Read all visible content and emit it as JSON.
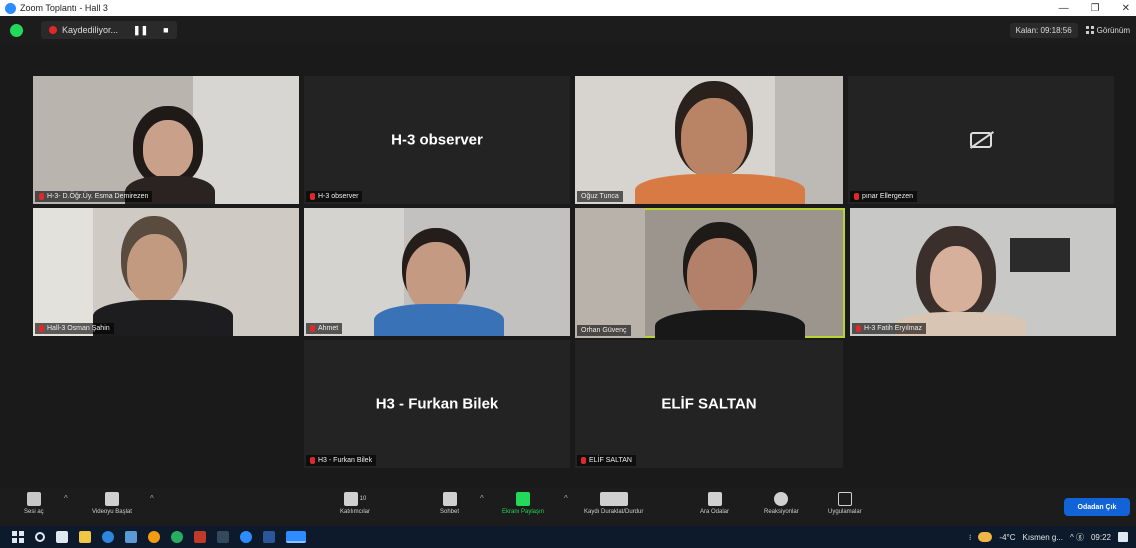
{
  "window": {
    "title": "Zoom Toplantı - Hall 3",
    "controls": [
      "—",
      "❐",
      "✕"
    ]
  },
  "topbar": {
    "recording_label": "Kaydediliyor...",
    "pause_glyph": "❚❚",
    "stop_glyph": "■",
    "timer": "Kalan: 09:18:56",
    "view_label": "Görünüm"
  },
  "participants": [
    {
      "name": "H-3- D.Öğr.Üy. Esma Demirezen",
      "video": true
    },
    {
      "name": "H-3 observer",
      "video": false,
      "display_name": "H-3 observer"
    },
    {
      "name": "Oğuz Tunca",
      "video": true
    },
    {
      "name": "pınar Ellergezen",
      "video": false,
      "camera_off": true
    },
    {
      "name": "Hall-3 Osman Şahin",
      "video": true
    },
    {
      "name": "Ahmet",
      "video": true
    },
    {
      "name": "Orhan Güvenç",
      "video": true,
      "speaking": true
    },
    {
      "name": "H-3 Fatih Eryılmaz",
      "video": true
    },
    {
      "name": "H3 - Furkan Bilek",
      "video": false,
      "display_name": "H3 - Furkan Bilek"
    },
    {
      "name": "ELİF SALTAN",
      "video": false,
      "display_name": "ELİF SALTAN"
    }
  ],
  "toolbar": {
    "mute": "Sesi aç",
    "video": "Videoyu Başlat",
    "participants": "Katılımcılar",
    "participants_count": "10",
    "chat": "Sohbet",
    "share": "Ekranı Paylaşın",
    "record": "Kaydı Duraklat/Durdur",
    "breakout": "Ara Odalar",
    "reactions": "Reaksiyonlar",
    "apps": "Uygulamalar",
    "leave": "Odadan Çık"
  },
  "taskbar": {
    "weather": "-4°C",
    "weather_text": "Kısmen g...",
    "tray_glyphs": "^ ⓖ",
    "time": "09:22",
    "icon_colors": [
      "#4aa3ff",
      "#f2c744",
      "#e74c3c",
      "#2e86de",
      "#f39c12",
      "#c0392b",
      "#34495e",
      "#2d8cff",
      "#27ae60",
      "#8e44ad",
      "#2d8cff",
      "#5a9bd5"
    ]
  },
  "colors": {
    "accent_green": "#23d959",
    "speaking_border": "#b8d432",
    "leave_button": "#1262d8",
    "muted_red": "#e02828"
  }
}
